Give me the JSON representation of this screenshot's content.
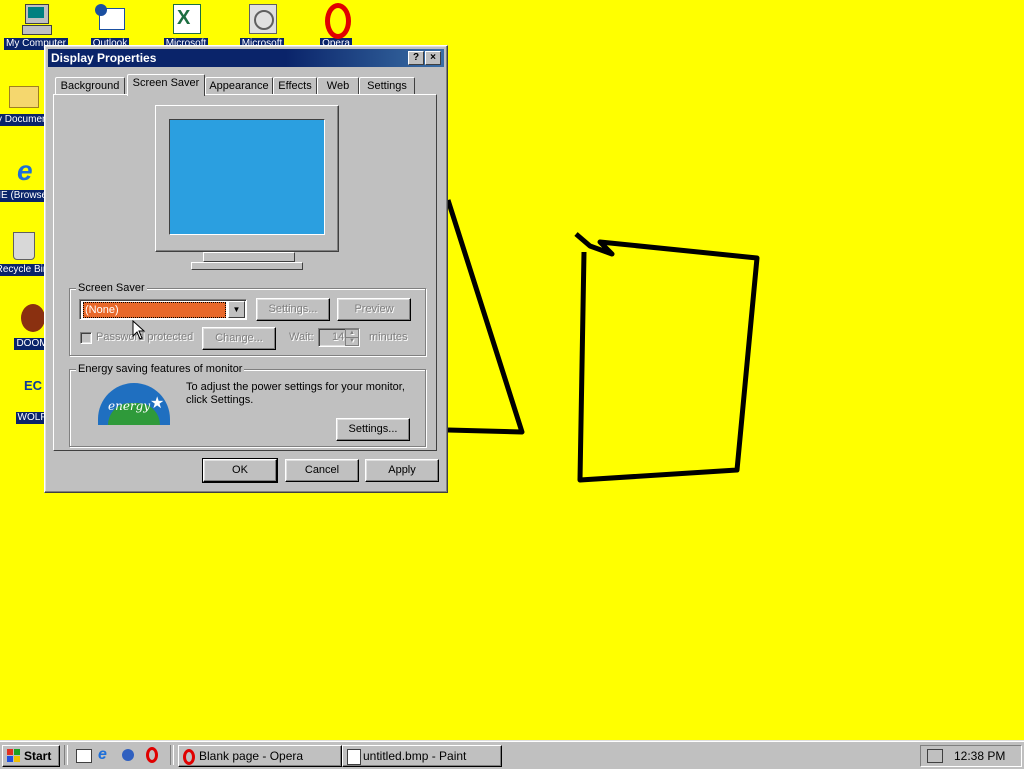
{
  "desktop": {
    "icons": [
      {
        "label": "My Computer",
        "icon": "my-computer-icon"
      },
      {
        "label": "Outlook",
        "icon": "outlook-icon"
      },
      {
        "label": "Microsoft",
        "icon": "excel-icon"
      },
      {
        "label": "Microsoft",
        "icon": "powerpoint-icon"
      },
      {
        "label": "Opera",
        "icon": "opera-icon"
      },
      {
        "label": "My Documents",
        "icon": "folder-icon"
      },
      {
        "label": "IE (Browser)",
        "icon": "internet-explorer-icon"
      },
      {
        "label": "Recycle Bin",
        "icon": "recycle-bin-icon"
      },
      {
        "label": "DOOM",
        "icon": "doom-icon"
      },
      {
        "label": "WOLF",
        "icon": "wolfenstein-icon"
      }
    ],
    "wallpaper_color": "#ffff00"
  },
  "dialog": {
    "title": "Display Properties",
    "help_button": "?",
    "close_button": "×",
    "tabs": [
      "Background",
      "Screen Saver",
      "Appearance",
      "Effects",
      "Web",
      "Settings"
    ],
    "active_tab": "Screen Saver",
    "screen_saver_group": {
      "label": "Screen Saver",
      "selected": "(None)",
      "settings_button": "Settings...",
      "preview_button": "Preview",
      "password_label": "Password protected",
      "change_button": "Change...",
      "wait_label": "Wait:",
      "wait_value": "14",
      "minutes_label": "minutes"
    },
    "energy_group": {
      "label": "Energy saving features of monitor",
      "description": "To adjust the power settings for your monitor, click Settings.",
      "settings_button": "Settings...",
      "logo_text": "energy"
    },
    "ok_button": "OK",
    "cancel_button": "Cancel",
    "apply_button": "Apply",
    "preview_screen_color": "#2b9fe0"
  },
  "taskbar": {
    "start_label": "Start",
    "quick_launch": [
      "desktop-icon",
      "internet-explorer-icon",
      "channels-icon",
      "opera-icon"
    ],
    "tasks": [
      {
        "label": "Blank page - Opera",
        "icon": "opera-icon"
      },
      {
        "label": "untitled.bmp - Paint",
        "icon": "paint-icon"
      }
    ],
    "clock": "12:38 PM",
    "tray_icon": "display-settings-icon"
  }
}
